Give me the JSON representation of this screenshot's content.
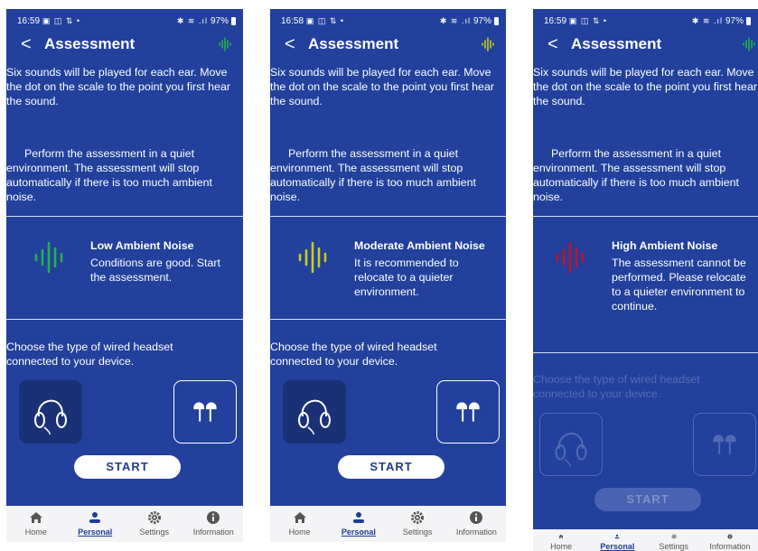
{
  "status_times": [
    "16:59",
    "16:58",
    "16:59"
  ],
  "battery": "97%",
  "header": {
    "title": "Assessment"
  },
  "instructions": {
    "para1": "Six sounds will be played for each ear. Move the dot on the scale to the point you first hear the sound.",
    "para2": "Perform the assessment in a quiet environment. The assessment will stop automatically if there is too much ambient noise."
  },
  "noise_states": [
    {
      "title": "Low Ambient Noise",
      "desc": "Conditions are good. Start the assessment.",
      "color": "#22b14c"
    },
    {
      "title": "Moderate Ambient Noise",
      "desc": "It is recommended to relocate to a quieter environment.",
      "color": "#c8cc1a"
    },
    {
      "title": "High Ambient Noise",
      "desc": "The assessment cannot be performed. Please relocate to a quieter environment to continue.",
      "color": "#c0142a"
    }
  ],
  "headset": {
    "prompt": "Choose the type of wired headset connected to your device.",
    "options": [
      "over-ear-headphones-icon",
      "earbuds-icon"
    ]
  },
  "start_label": "START",
  "nav": [
    {
      "label": "Home",
      "icon": "home-icon"
    },
    {
      "label": "Personal",
      "icon": "person-icon",
      "active": true
    },
    {
      "label": "Settings",
      "icon": "gear-icon"
    },
    {
      "label": "Information",
      "icon": "info-icon"
    }
  ],
  "colors": {
    "background": "#22409c",
    "accent_green": "#22b14c"
  }
}
